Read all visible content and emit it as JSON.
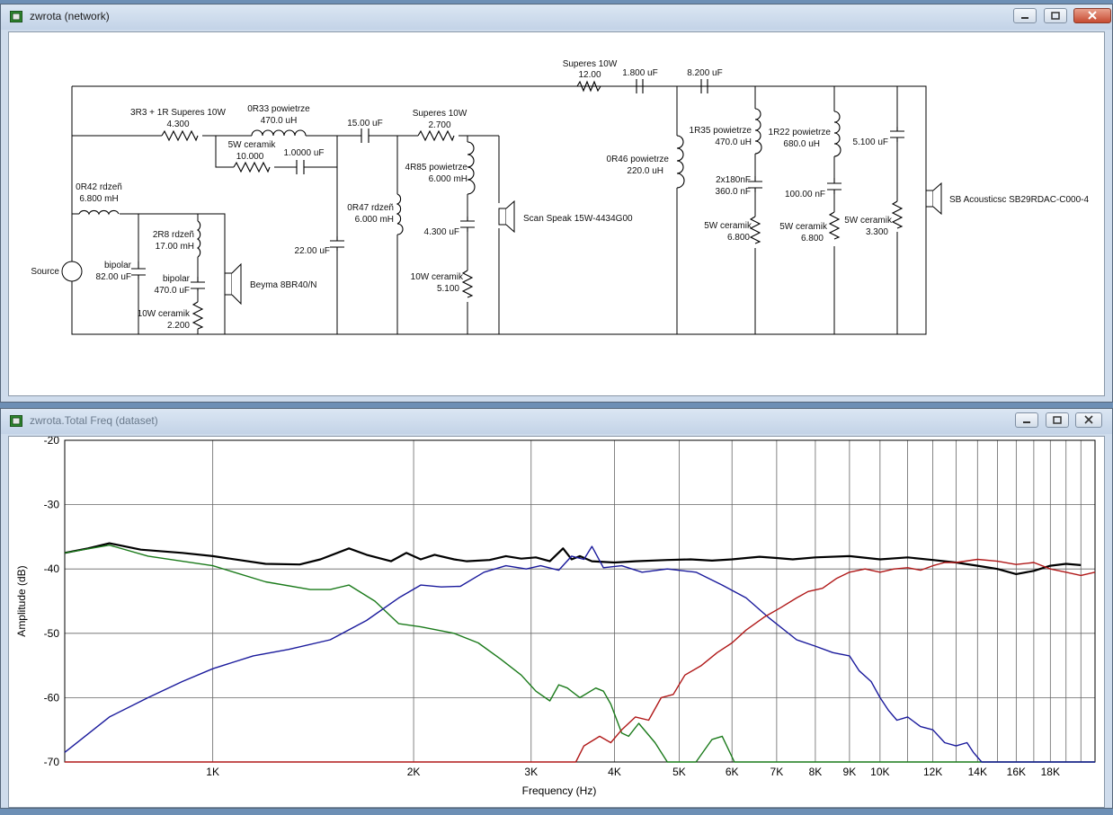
{
  "network_window": {
    "title": "zwrota (network)",
    "source_label": "Source",
    "components": {
      "r_superes_top_name": "Superes 10W",
      "r_superes_top_val": "12.00",
      "c_top1": "1.800 uF",
      "c_top2": "8.200 uF",
      "r_3r3_name": "3R3 + 1R Superes 10W",
      "r_3r3_val": "4.300",
      "l_0r33_name": "0R33 powietrze",
      "l_0r33_val": "470.0 uH",
      "r_5w_name": "5W ceramik",
      "r_5w_val": "10.000",
      "c_1uf": "1.0000 uF",
      "c_15uf": "15.00 uF",
      "r_superes_mid_name": "Superes 10W",
      "r_superes_mid_val": "2.700",
      "l_0r42_name": "0R42 rdzeñ",
      "l_0r42_val": "6.800 mH",
      "l_2r8_name": "2R8 rdzeñ",
      "l_2r8_val": "17.00 mH",
      "c_bipolar1_name": "bipolar",
      "c_bipolar1_val": "82.00 uF",
      "c_bipolar2_name": "bipolar",
      "c_bipolar2_val": "470.0 uF",
      "r_10w_a_name": "10W ceramik",
      "r_10w_a_val": "2.200",
      "speaker_woofer": "Beyma 8BR40/N",
      "c_22uf": "22.00 uF",
      "l_0r47_name": "0R47 rdzeñ",
      "l_0r47_val": "6.000 mH",
      "l_4r85_name": "4R85 powietrze",
      "l_4r85_val": "6.000 mH",
      "c_4_3uf": "4.300 uF",
      "r_10w_b_name": "10W ceramik",
      "r_10w_b_val": "5.100",
      "speaker_mid": "Scan Speak 15W-4434G00",
      "l_0r46_name": "0R46 powietrze",
      "l_0r46_val": "220.0 uH",
      "l_1r35_name": "1R35 powietrze",
      "l_1r35_val": "470.0 uH",
      "c_2x180_name": "2x180nF",
      "c_2x180_val": "360.0 nF",
      "r_5w_b_name": "5W ceramik",
      "r_5w_b_val": "6.800",
      "l_1r22_name": "1R22 powietrze",
      "l_1r22_val": "680.0 uH",
      "c_100nf": "100.00 nF",
      "r_5w_c_name": "5W ceramik",
      "r_5w_c_val": "6.800",
      "c_5_1uf": "5.100 uF",
      "r_5w_d_name": "5W ceramik",
      "r_5w_d_val": "3.300",
      "speaker_tweeter": "SB Acousticsc SB29RDAC-C000-4"
    }
  },
  "freq_window": {
    "title": "zwrota.Total Freq (dataset)"
  },
  "colors": {
    "total": "#000000",
    "woofer": "#1a7a1a",
    "mid": "#1a1a9c",
    "tweeter": "#b01818"
  },
  "chart_data": {
    "type": "line",
    "xlabel": "Frequency (Hz)",
    "ylabel": "Amplitude (dB)",
    "x_scale": "log",
    "xlim": [
      600,
      21000
    ],
    "ylim": [
      -70,
      -20
    ],
    "y_ticks": [
      -20,
      -30,
      -40,
      -50,
      -60,
      -70
    ],
    "x_tick_labels": [
      {
        "f": 1000,
        "label": "1K"
      },
      {
        "f": 2000,
        "label": "2K"
      },
      {
        "f": 3000,
        "label": "3K"
      },
      {
        "f": 4000,
        "label": "4K"
      },
      {
        "f": 5000,
        "label": "5K"
      },
      {
        "f": 6000,
        "label": "6K"
      },
      {
        "f": 7000,
        "label": "7K"
      },
      {
        "f": 8000,
        "label": "8K"
      },
      {
        "f": 9000,
        "label": "9K"
      },
      {
        "f": 10000,
        "label": "10K"
      },
      {
        "f": 12000,
        "label": "12K"
      },
      {
        "f": 14000,
        "label": "14K"
      },
      {
        "f": 16000,
        "label": "16K"
      },
      {
        "f": 18000,
        "label": "18K"
      }
    ],
    "x_gridlines": [
      1000,
      2000,
      3000,
      4000,
      5000,
      6000,
      7000,
      8000,
      9000,
      10000,
      11000,
      12000,
      13000,
      14000,
      15000,
      16000,
      17000,
      18000,
      19000,
      20000
    ],
    "grid": true,
    "series": [
      {
        "key": "total",
        "points": [
          [
            600,
            -37.5
          ],
          [
            650,
            -36.8
          ],
          [
            700,
            -36
          ],
          [
            780,
            -37
          ],
          [
            900,
            -37.5
          ],
          [
            1000,
            -38
          ],
          [
            1200,
            -39.2
          ],
          [
            1350,
            -39.3
          ],
          [
            1450,
            -38.5
          ],
          [
            1600,
            -36.8
          ],
          [
            1700,
            -37.8
          ],
          [
            1850,
            -38.8
          ],
          [
            1950,
            -37.5
          ],
          [
            2050,
            -38.5
          ],
          [
            2150,
            -37.8
          ],
          [
            2300,
            -38.5
          ],
          [
            2400,
            -38.8
          ],
          [
            2600,
            -38.6
          ],
          [
            2750,
            -38
          ],
          [
            2900,
            -38.4
          ],
          [
            3050,
            -38.2
          ],
          [
            3200,
            -38.8
          ],
          [
            3350,
            -36.8
          ],
          [
            3450,
            -38.5
          ],
          [
            3550,
            -38
          ],
          [
            3700,
            -38.8
          ],
          [
            4000,
            -39
          ],
          [
            4300,
            -38.8
          ],
          [
            4800,
            -38.6
          ],
          [
            5200,
            -38.5
          ],
          [
            5600,
            -38.7
          ],
          [
            6000,
            -38.5
          ],
          [
            6300,
            -38.3
          ],
          [
            6600,
            -38.1
          ],
          [
            7000,
            -38.3
          ],
          [
            7400,
            -38.5
          ],
          [
            8000,
            -38.2
          ],
          [
            9000,
            -38
          ],
          [
            10000,
            -38.5
          ],
          [
            11000,
            -38.2
          ],
          [
            12000,
            -38.6
          ],
          [
            13000,
            -39
          ],
          [
            14000,
            -39.5
          ],
          [
            15000,
            -40
          ],
          [
            16000,
            -40.8
          ],
          [
            17000,
            -40.3
          ],
          [
            18000,
            -39.5
          ],
          [
            19000,
            -39.2
          ],
          [
            20000,
            -39.4
          ]
        ]
      },
      {
        "key": "woofer",
        "points": [
          [
            600,
            -37.5
          ],
          [
            700,
            -36.3
          ],
          [
            800,
            -38
          ],
          [
            900,
            -38.8
          ],
          [
            1000,
            -39.5
          ],
          [
            1200,
            -42
          ],
          [
            1400,
            -43.2
          ],
          [
            1500,
            -43.2
          ],
          [
            1600,
            -42.5
          ],
          [
            1750,
            -45
          ],
          [
            1900,
            -48.5
          ],
          [
            2050,
            -49
          ],
          [
            2300,
            -50
          ],
          [
            2500,
            -51.5
          ],
          [
            2700,
            -54
          ],
          [
            2900,
            -56.5
          ],
          [
            3050,
            -59
          ],
          [
            3200,
            -60.5
          ],
          [
            3300,
            -58
          ],
          [
            3400,
            -58.5
          ],
          [
            3550,
            -60
          ],
          [
            3750,
            -58.5
          ],
          [
            3850,
            -59
          ],
          [
            3950,
            -61
          ],
          [
            4100,
            -65.5
          ],
          [
            4200,
            -66
          ],
          [
            4350,
            -64
          ],
          [
            4600,
            -67
          ],
          [
            4800,
            -70
          ],
          [
            5300,
            -70
          ],
          [
            5600,
            -66.5
          ],
          [
            5800,
            -66
          ],
          [
            6050,
            -70
          ],
          [
            21000,
            -70
          ]
        ]
      },
      {
        "key": "mid",
        "points": [
          [
            600,
            -68.5
          ],
          [
            700,
            -63
          ],
          [
            800,
            -60
          ],
          [
            900,
            -57.5
          ],
          [
            1000,
            -55.5
          ],
          [
            1150,
            -53.5
          ],
          [
            1300,
            -52.5
          ],
          [
            1500,
            -51
          ],
          [
            1700,
            -48
          ],
          [
            1900,
            -44.5
          ],
          [
            2050,
            -42.5
          ],
          [
            2200,
            -42.8
          ],
          [
            2350,
            -42.7
          ],
          [
            2550,
            -40.5
          ],
          [
            2750,
            -39.5
          ],
          [
            2950,
            -40
          ],
          [
            3100,
            -39.5
          ],
          [
            3300,
            -40.2
          ],
          [
            3450,
            -38
          ],
          [
            3600,
            -38.5
          ],
          [
            3700,
            -36.5
          ],
          [
            3850,
            -39.8
          ],
          [
            4100,
            -39.5
          ],
          [
            4400,
            -40.5
          ],
          [
            4800,
            -40
          ],
          [
            5300,
            -40.5
          ],
          [
            5800,
            -42.5
          ],
          [
            6300,
            -44.5
          ],
          [
            6800,
            -47.5
          ],
          [
            7500,
            -51
          ],
          [
            8000,
            -52
          ],
          [
            8500,
            -53
          ],
          [
            9000,
            -53.5
          ],
          [
            9300,
            -55.8
          ],
          [
            9700,
            -57.5
          ],
          [
            10000,
            -60
          ],
          [
            10300,
            -62
          ],
          [
            10600,
            -63.5
          ],
          [
            11000,
            -63
          ],
          [
            11500,
            -64.5
          ],
          [
            12000,
            -65
          ],
          [
            12500,
            -67
          ],
          [
            13000,
            -67.5
          ],
          [
            13500,
            -67
          ],
          [
            13800,
            -68.5
          ],
          [
            14200,
            -70
          ],
          [
            21000,
            -70
          ]
        ]
      },
      {
        "key": "tweeter",
        "points": [
          [
            600,
            -70
          ],
          [
            3200,
            -70
          ],
          [
            3500,
            -70
          ],
          [
            3600,
            -67.5
          ],
          [
            3800,
            -66
          ],
          [
            3950,
            -67
          ],
          [
            4100,
            -65
          ],
          [
            4300,
            -63
          ],
          [
            4500,
            -63.5
          ],
          [
            4700,
            -60
          ],
          [
            4900,
            -59.5
          ],
          [
            5100,
            -56.5
          ],
          [
            5400,
            -55
          ],
          [
            5700,
            -53
          ],
          [
            6000,
            -51.5
          ],
          [
            6300,
            -49.5
          ],
          [
            6700,
            -47.5
          ],
          [
            7100,
            -46
          ],
          [
            7500,
            -44.5
          ],
          [
            7800,
            -43.5
          ],
          [
            8200,
            -43
          ],
          [
            8600,
            -41.5
          ],
          [
            9000,
            -40.5
          ],
          [
            9500,
            -40
          ],
          [
            10000,
            -40.5
          ],
          [
            10500,
            -40
          ],
          [
            11000,
            -39.8
          ],
          [
            11500,
            -40.2
          ],
          [
            12000,
            -39.5
          ],
          [
            12500,
            -39
          ],
          [
            13000,
            -39
          ],
          [
            14000,
            -38.5
          ],
          [
            15000,
            -38.8
          ],
          [
            16000,
            -39.3
          ],
          [
            17000,
            -39
          ],
          [
            18000,
            -40
          ],
          [
            19000,
            -40.5
          ],
          [
            20000,
            -41
          ],
          [
            21000,
            -40.5
          ]
        ]
      }
    ]
  }
}
